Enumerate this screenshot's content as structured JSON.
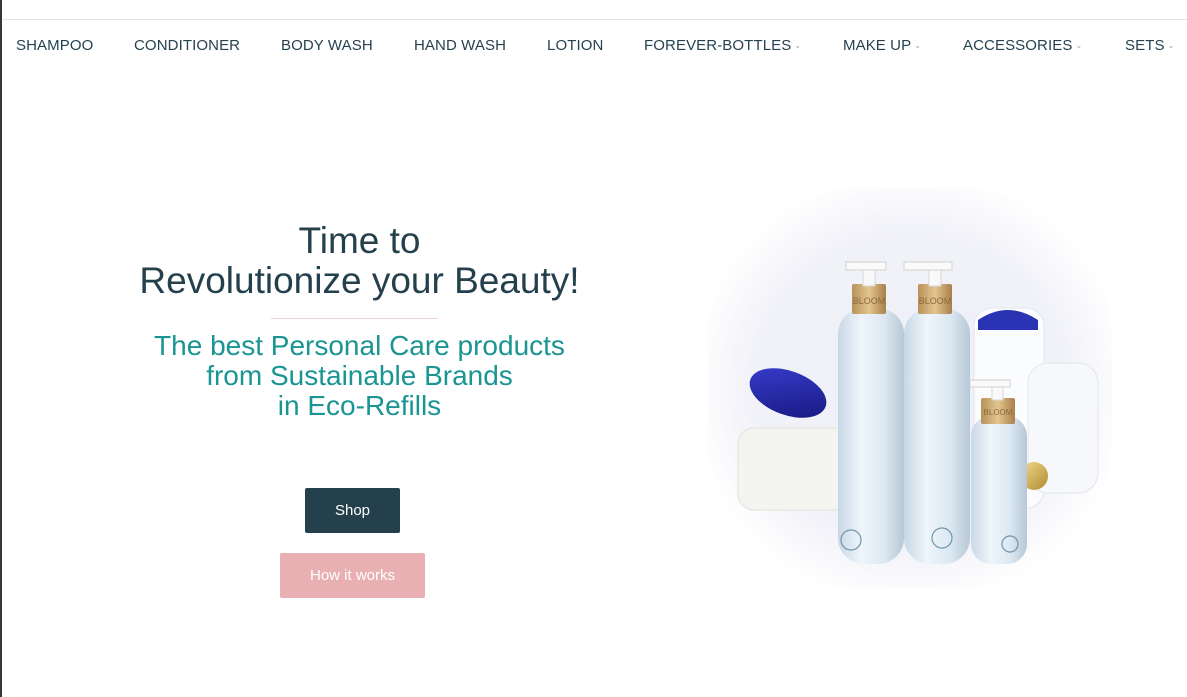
{
  "nav": {
    "items": [
      {
        "label": "SHAMPOO",
        "has_dropdown": false
      },
      {
        "label": "CONDITIONER",
        "has_dropdown": false
      },
      {
        "label": "BODY WASH",
        "has_dropdown": false
      },
      {
        "label": "HAND WASH",
        "has_dropdown": false
      },
      {
        "label": "LOTION",
        "has_dropdown": false
      },
      {
        "label": "FOREVER-BOTTLES",
        "has_dropdown": true
      },
      {
        "label": "MAKE UP",
        "has_dropdown": true
      },
      {
        "label": "ACCESSORIES",
        "has_dropdown": true
      },
      {
        "label": "SETS",
        "has_dropdown": true
      }
    ]
  },
  "hero": {
    "title_line1": "Time to",
    "title_line2": "Revolutionize your Beauty!",
    "subtitle_line1": "The best Personal Care products",
    "subtitle_line2": "from Sustainable Brands",
    "subtitle_line3": "in Eco-Refills",
    "shop_label": "Shop",
    "how_label": "How it works",
    "bottle_label": "BLOOM"
  },
  "colors": {
    "primary": "#24404d",
    "teal": "#1a9593",
    "pink": "#e8b0b2",
    "divider": "#f2cfd2"
  },
  "icons": {
    "dropdown": "chevron-down-icon"
  }
}
